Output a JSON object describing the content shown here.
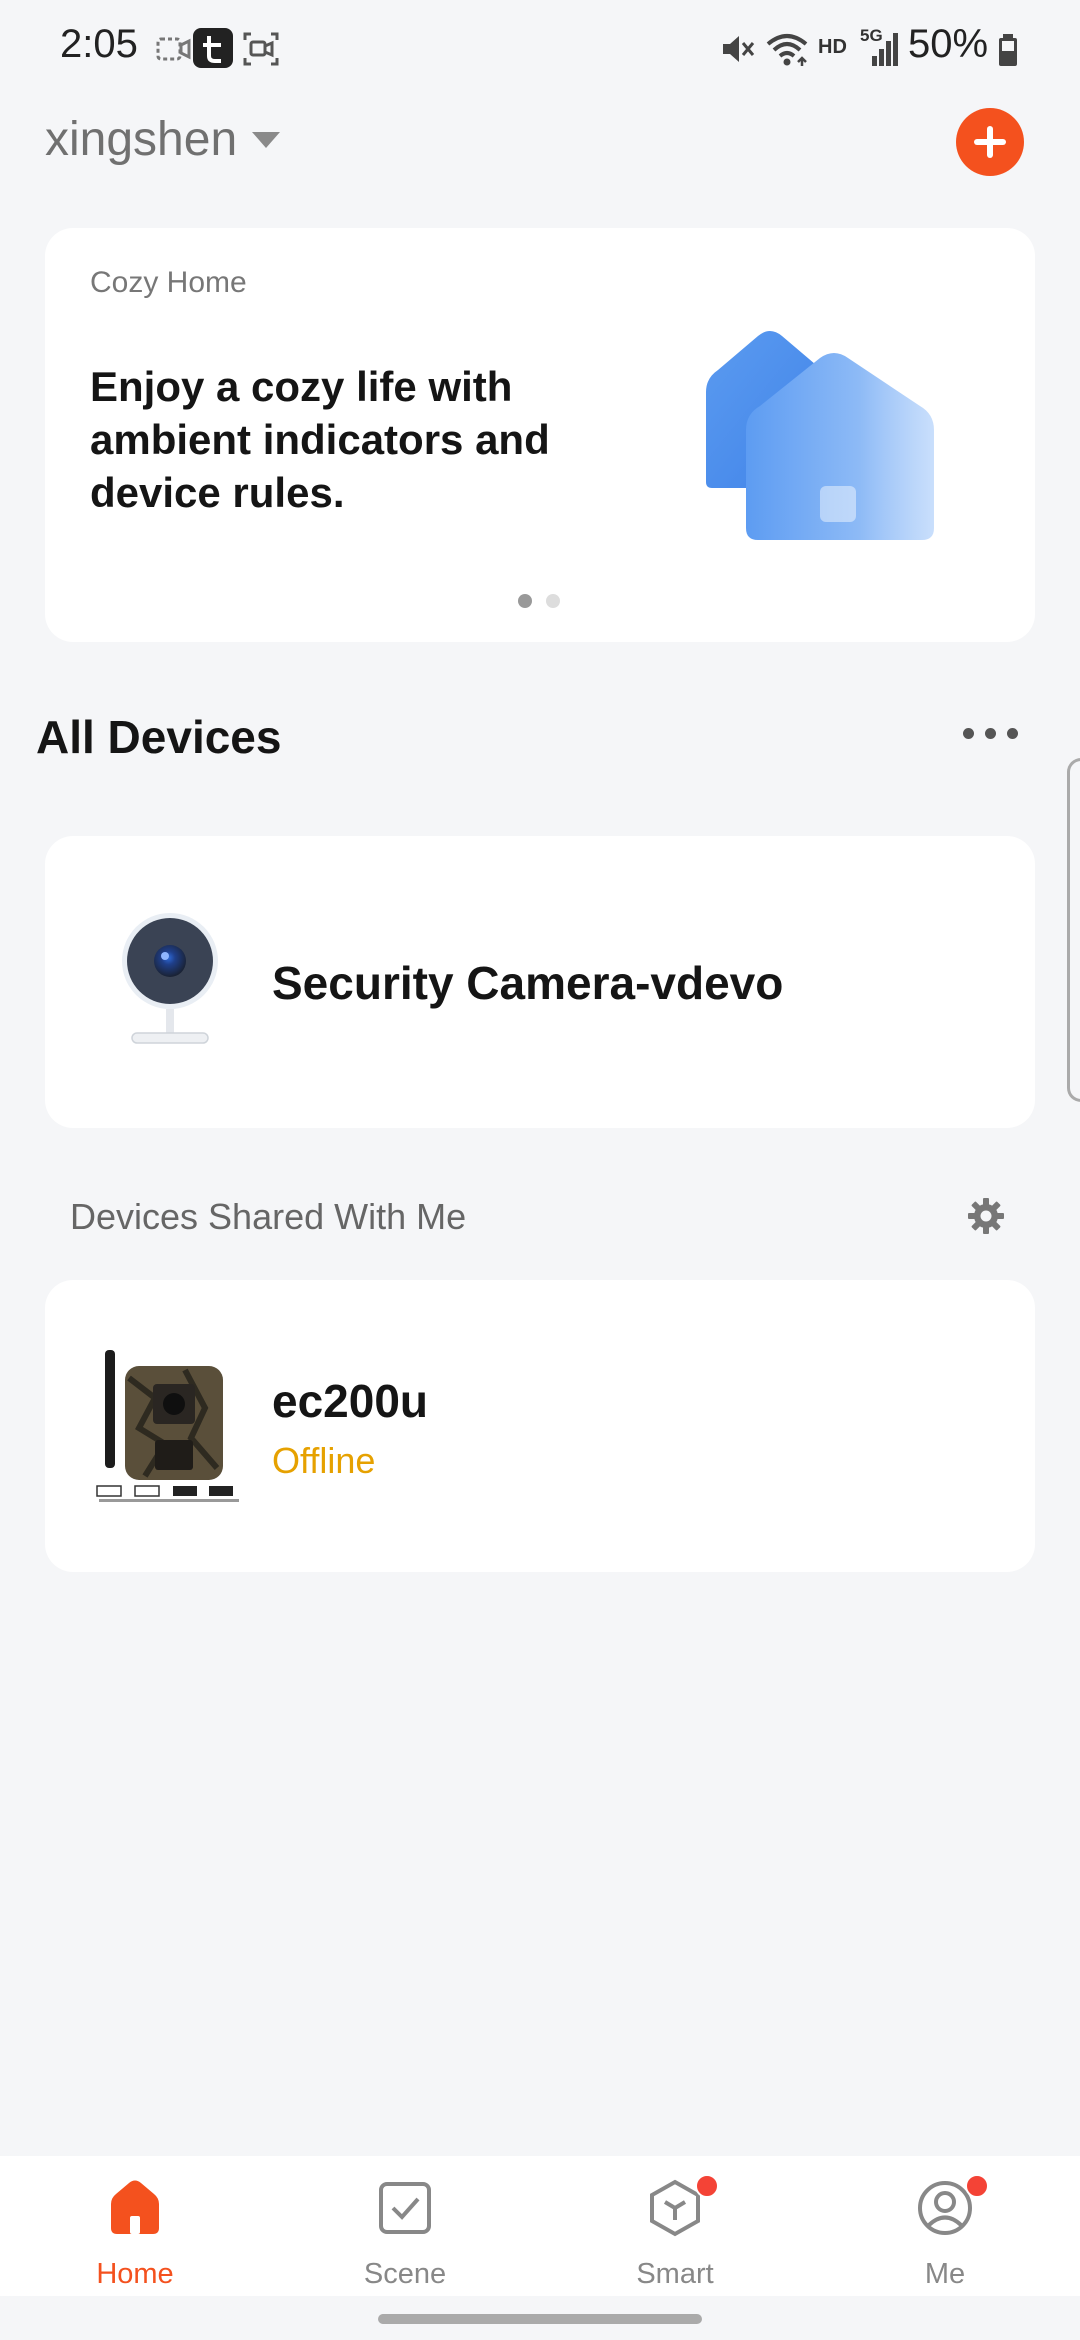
{
  "status_bar": {
    "time": "2:05",
    "battery_percent": "50%",
    "network_label": "HD",
    "signal_label": "5G"
  },
  "header": {
    "account_name": "xingshen"
  },
  "banner": {
    "eyebrow": "Cozy Home",
    "text": "Enjoy a cozy life with ambient indicators and device rules.",
    "active_page": 1,
    "page_count": 2
  },
  "all_devices": {
    "title": "All Devices",
    "devices": [
      {
        "name": "Security Camera-vdevo"
      }
    ]
  },
  "shared": {
    "title": "Devices Shared With Me",
    "devices": [
      {
        "name": "ec200u",
        "status": "Offline"
      }
    ]
  },
  "nav": [
    {
      "label": "Home",
      "icon": "home-icon",
      "active": true
    },
    {
      "label": "Scene",
      "icon": "scene-icon",
      "active": false
    },
    {
      "label": "Smart",
      "icon": "smart-icon",
      "active": false,
      "badge": true
    },
    {
      "label": "Me",
      "icon": "profile-icon",
      "active": false,
      "badge": true
    }
  ],
  "colors": {
    "accent": "#f4511e",
    "offline": "#e6a100",
    "background": "#f5f6f8"
  }
}
